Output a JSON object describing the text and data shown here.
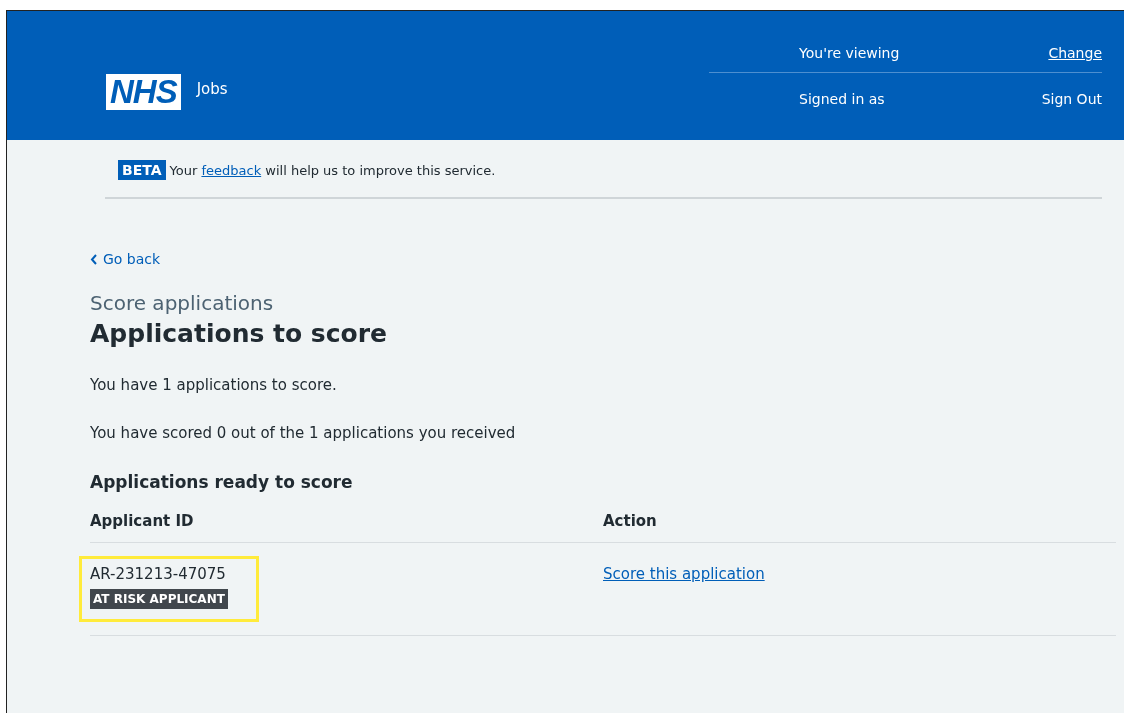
{
  "header": {
    "logo": "NHS",
    "service": "Jobs",
    "account": [
      {
        "label": "You're viewing",
        "link": "Change"
      },
      {
        "label": "Signed in as",
        "link": "Sign Out"
      }
    ]
  },
  "phase_banner": {
    "tag": "BETA",
    "text_before": "Your",
    "link": "feedback",
    "text_after": "will help us to improve this service."
  },
  "back_link": "Go back",
  "caption": "Score applications",
  "title": "Applications to score",
  "paragraphs": [
    "You have 1 applications to score.",
    "You have scored 0 out of the 1 applications you received"
  ],
  "table": {
    "title": "Applications ready to score",
    "columns": [
      "Applicant ID",
      "Action"
    ],
    "rows": [
      {
        "applicant_id": "AR-231213-47075",
        "tag": "AT RISK APPLICANT",
        "action": "Score this application",
        "highlighted": true
      }
    ]
  }
}
